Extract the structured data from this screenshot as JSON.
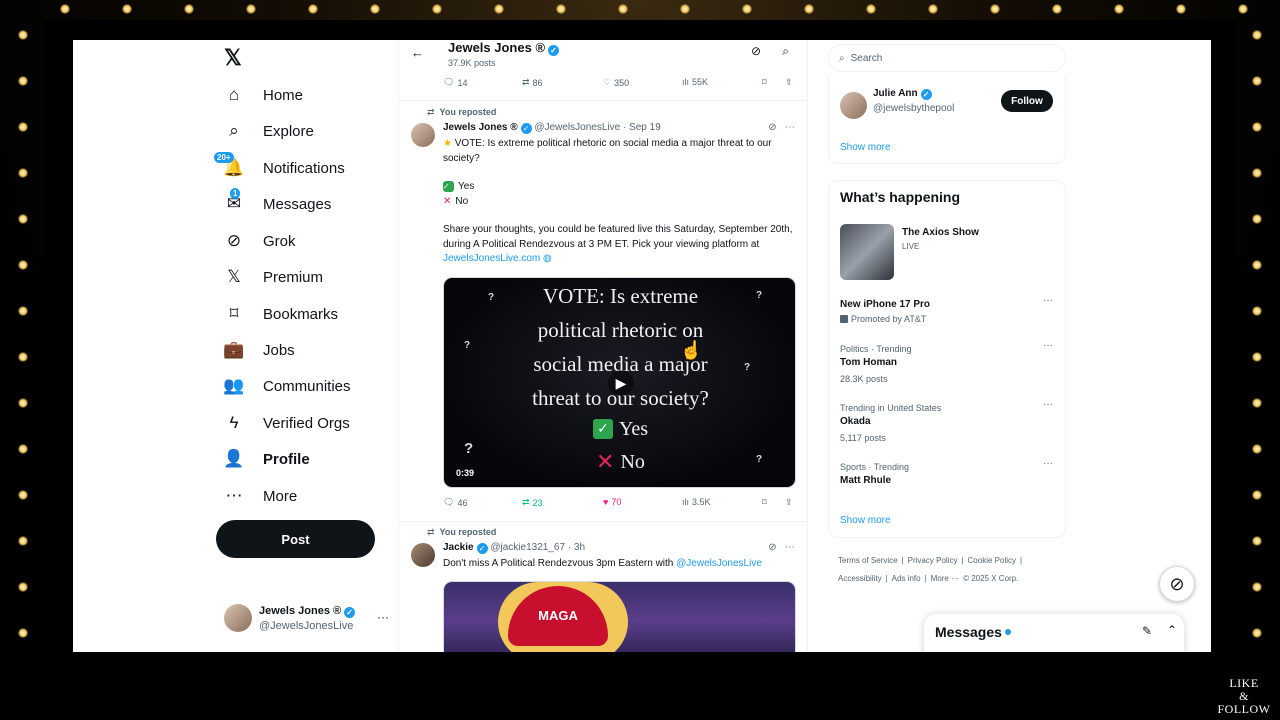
{
  "nav": {
    "items": [
      {
        "label": "Home",
        "icon": "home-icon",
        "glyph": "⌂"
      },
      {
        "label": "Explore",
        "icon": "search-icon",
        "glyph": "⌕"
      },
      {
        "label": "Notifications",
        "icon": "bell-icon",
        "glyph": "🔔",
        "badge": "20+"
      },
      {
        "label": "Messages",
        "icon": "mail-icon",
        "glyph": "✉",
        "badge": "1"
      },
      {
        "label": "Grok",
        "icon": "grok-icon",
        "glyph": "⊘"
      },
      {
        "label": "Premium",
        "icon": "x-logo-icon",
        "glyph": "𝕏"
      },
      {
        "label": "Bookmarks",
        "icon": "bookmark-icon",
        "glyph": "⌑"
      },
      {
        "label": "Jobs",
        "icon": "briefcase-icon",
        "glyph": "💼"
      },
      {
        "label": "Communities",
        "icon": "people-icon",
        "glyph": "👥"
      },
      {
        "label": "Verified Orgs",
        "icon": "lightning-icon",
        "glyph": "ϟ"
      },
      {
        "label": "Profile",
        "icon": "person-icon",
        "glyph": "👤"
      },
      {
        "label": "More",
        "icon": "more-circle-icon",
        "glyph": "⋯"
      }
    ],
    "post_label": "Post",
    "account": {
      "name": "Jewels Jones ®",
      "handle": "@JewelsJonesLive",
      "more": "···"
    },
    "logo": "𝕏"
  },
  "header": {
    "title": "Jewels Jones ®",
    "subtitle": "37.9K posts",
    "back": "←"
  },
  "top_actions": {
    "replies": "14",
    "reposts": "86",
    "likes": "350",
    "views": "55K"
  },
  "tweet1": {
    "reposted": "You reposted",
    "name": "Jewels Jones ®",
    "handle": "@JewelsJonesLive",
    "date": "· Sep 19",
    "text_line1": "VOTE: Is extreme political rhetoric on social media a major threat to our society?",
    "opt_yes": "Yes",
    "opt_no": "No",
    "text_line2": "Share your thoughts, you could be featured live this Saturday, September 20th, during A Political Rendezvous at 3 PM ET. Pick your viewing platform at",
    "link": "JewelsJonesLive.com",
    "video": {
      "line1": "VOTE: Is extreme",
      "line2": "political rhetoric on",
      "line3": "social media a major",
      "line4": "threat to our society?",
      "yes": "Yes",
      "no": "No",
      "duration": "0:39"
    },
    "actions": {
      "replies": "46",
      "reposts": "23",
      "likes": "70",
      "views": "3.5K"
    }
  },
  "tweet2": {
    "reposted": "You reposted",
    "name": "Jackie",
    "handle": "@jackie1321_67",
    "date": "· 3h",
    "text": "Don't miss A Political Rendezvous 3pm Eastern with",
    "mention": "@JewelsJonesLive",
    "hat_text": "MAGA"
  },
  "right": {
    "search_placeholder": "Search",
    "who_to_follow": {
      "name": "Julie Ann",
      "handle": "@jewelsbythepool",
      "button": "Follow"
    },
    "show_more": "Show more",
    "happening_title": "What’s happening",
    "axios": {
      "title": "The Axios Show",
      "status": "LIVE"
    },
    "trends": [
      {
        "meta": "",
        "name": "New iPhone 17 Pro",
        "sub": "Promoted by AT&T"
      },
      {
        "meta": "Politics · Trending",
        "name": "Tom Homan",
        "sub": "28.3K posts"
      },
      {
        "meta": "Trending in United States",
        "name": "Okada",
        "sub": "5,117 posts"
      },
      {
        "meta": "Sports · Trending",
        "name": "Matt Rhule",
        "sub": ""
      }
    ],
    "show_more2": "Show more",
    "footer1": [
      "Terms of Service",
      "|",
      "Privacy Policy",
      "|",
      "Cookie Policy",
      "|"
    ],
    "footer2": [
      "Accessibility",
      "|",
      "Ads info",
      "|",
      "More ···",
      "© 2025 X Corp."
    ]
  },
  "messages_drawer": {
    "title": "Messages"
  },
  "watermark": {
    "line1": "LIKE",
    "line2": "&",
    "line3": "FOLLOW"
  },
  "colors": {
    "accent": "#1d9bf0",
    "like": "#f91880",
    "repost": "#00ba7c",
    "text": "#0f1419",
    "muted": "#536471"
  }
}
